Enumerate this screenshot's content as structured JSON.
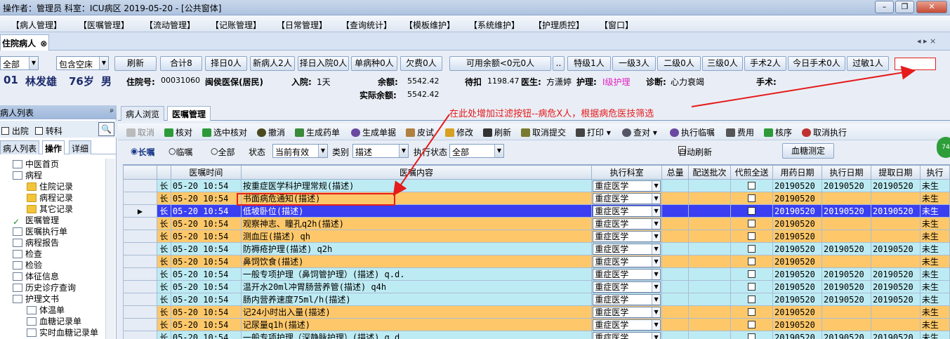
{
  "titlebar": {
    "text": "操作者：管理员  科室：ICU病区  2019-05-20 - [公共窗体]"
  },
  "window_controls": {
    "min": "–",
    "restore": "❐",
    "close": "✕"
  },
  "menu": [
    "【病人管理】",
    "【医嘱管理】",
    "【流动管理】",
    "【记账管理】",
    "【日常管理】",
    "【查询统计】",
    "【模板维护】",
    "【系统维护】",
    "【护理质控】",
    "【窗口】"
  ],
  "doc_tab": {
    "label": "住院病人",
    "close": "⊗"
  },
  "nav_arrows": "◂ ▸ ×",
  "filter_bar": {
    "scope": "全部",
    "bed": "包含空床",
    "more": ".."
  },
  "top_buttons": [
    "刷新",
    "合计8",
    "择日0人",
    "新病人2人",
    "择日入院0人",
    "单病种0人",
    "欠费0人",
    "可用余额<0元0人",
    "特级1人",
    "一级3人",
    "二级0人",
    "三级0人",
    "手术2人",
    "今日手术0人",
    "过敏1人"
  ],
  "patient": {
    "bed": "01",
    "name": "林发雄",
    "age": "76岁",
    "sex": "男",
    "inpatient_label": "住院号:",
    "inpatient_no": "00031060",
    "insurance": "闽侯医保(居民)",
    "admit_label": "入院:",
    "admit": "1天",
    "balance_label": "余额:",
    "balance": "5542.42",
    "pending_label": "待扣",
    "pending": "1198.47",
    "doctor_label": "医生:",
    "doctor": "方潇婷",
    "nursing_label": "护理:",
    "nursing": "I级护理",
    "diag_label": "诊断:",
    "diag": "心力衰竭",
    "surgery_label": "手术:",
    "actual_label": "实际余额:",
    "actual": "5542.42"
  },
  "left": {
    "title": "病人列表",
    "pin": "ᵖ",
    "checks": [
      "出院",
      "转科"
    ],
    "tabs": [
      "病人列表",
      "操作",
      "详细"
    ],
    "tree": [
      "中医首页",
      "病程",
      "住院记录",
      "病程记录",
      "其它记录",
      "医嘱管理",
      "医嘱执行单",
      "病程报告",
      "检查",
      "检验",
      "体征信息",
      "历史诊疗查询",
      "护理文书",
      "体温单",
      "血糖记录单",
      "实时血糖记录单"
    ]
  },
  "right": {
    "tabs": [
      "病人浏览",
      "医嘱管理"
    ],
    "toolbar": [
      "取消",
      "核对",
      "选中核对",
      "撤消",
      "生成药单",
      "生成单据",
      "皮试",
      "修改",
      "刷新",
      "取消提交",
      "打印",
      "查对",
      "执行临嘱",
      "费用",
      "核序",
      "取消执行"
    ],
    "filters": {
      "long": "长嘱",
      "temp": "临嘱",
      "all": "全部",
      "state_label": "状态",
      "state": "当前有效",
      "type_label": "类别",
      "type": "描述",
      "exec_label": "执行状态",
      "exec": "全部",
      "auto": "自动刷新",
      "glucose": "血糖测定"
    }
  },
  "annotation": "在此处增加过滤按钮--病危X人，根据病危医技筛选",
  "badge": "74",
  "grid": {
    "headers": [
      "",
      "",
      "医嘱时间",
      "医嘱内容",
      "执行科室",
      "总量",
      "配送批次",
      "代煎全送",
      "用药日期",
      "执行日期",
      "提取日期",
      "执行"
    ],
    "rows": [
      {
        "k": "c",
        "mark": "",
        "t": "长",
        "time": "05-20 10:54",
        "content": "按重症医学科护理常规(描述)",
        "dept": "重症医学",
        "d1": "20190520",
        "d2": "20190520",
        "d3": "20190520",
        "st": "未生"
      },
      {
        "k": "o",
        "mark": "",
        "t": "长",
        "time": "05-20 10:54",
        "content": "书面病危通知(描述)",
        "dept": "重症医学",
        "d1": "20190520",
        "d2": "",
        "d3": "",
        "st": "未生"
      },
      {
        "k": "s",
        "mark": "▶",
        "t": "长",
        "time": "05-20 10:54",
        "content": "低坡卧位(描述)",
        "dept": "重症医学",
        "d1": "20190520",
        "d2": "20190520",
        "d3": "20190520",
        "st": "未生"
      },
      {
        "k": "o",
        "mark": "",
        "t": "长",
        "time": "05-20 10:54",
        "content": "观察神志、瞳孔q2h(描述)",
        "dept": "重症医学",
        "d1": "20190520",
        "d2": "",
        "d3": "",
        "st": "未生"
      },
      {
        "k": "o",
        "mark": "",
        "t": "长",
        "time": "05-20 10:54",
        "content": "测血压(描述) qh",
        "dept": "重症医学",
        "d1": "20190520",
        "d2": "",
        "d3": "",
        "st": "未生"
      },
      {
        "k": "c",
        "mark": "",
        "t": "长",
        "time": "05-20 10:54",
        "content": "防褥疮护理(描述) q2h",
        "dept": "重症医学",
        "d1": "20190520",
        "d2": "20190520",
        "d3": "20190520",
        "st": "未生"
      },
      {
        "k": "o",
        "mark": "",
        "t": "长",
        "time": "05-20 10:54",
        "content": "鼻饲饮食(描述)",
        "dept": "重症医学",
        "d1": "20190520",
        "d2": "",
        "d3": "",
        "st": "未生"
      },
      {
        "k": "c",
        "mark": "",
        "t": "长",
        "time": "05-20 10:54",
        "content": "一般专项护理（鼻饲管护理）(描述) q.d.",
        "dept": "重症医学",
        "d1": "20190520",
        "d2": "20190520",
        "d3": "20190520",
        "st": "未生"
      },
      {
        "k": "c",
        "mark": "",
        "t": "长",
        "time": "05-20 10:54",
        "content": "温开水20ml冲胃肠营养管(描述) q4h",
        "dept": "重症医学",
        "d1": "20190520",
        "d2": "20190520",
        "d3": "20190520",
        "st": "未生"
      },
      {
        "k": "c",
        "mark": "",
        "t": "长",
        "time": "05-20 10:54",
        "content": "肠内营养速度75ml/h(描述)",
        "dept": "重症医学",
        "d1": "20190520",
        "d2": "20190520",
        "d3": "20190520",
        "st": "未生"
      },
      {
        "k": "o",
        "mark": "",
        "t": "长",
        "time": "05-20 10:54",
        "content": "记24小时出入量(描述)",
        "dept": "重症医学",
        "d1": "20190520",
        "d2": "",
        "d3": "",
        "st": "未生"
      },
      {
        "k": "o",
        "mark": "",
        "t": "长",
        "time": "05-20 10:54",
        "content": "记尿量q1h(描述)",
        "dept": "重症医学",
        "d1": "20190520",
        "d2": "",
        "d3": "",
        "st": "未生"
      },
      {
        "k": "c",
        "mark": "",
        "t": "长",
        "time": "05-20 10:54",
        "content": "一般专项护理（深静脉护理）(描述) q.d.",
        "dept": "重症医学",
        "d1": "20190520",
        "d2": "20190520",
        "d3": "20190520",
        "st": "未生"
      }
    ]
  }
}
